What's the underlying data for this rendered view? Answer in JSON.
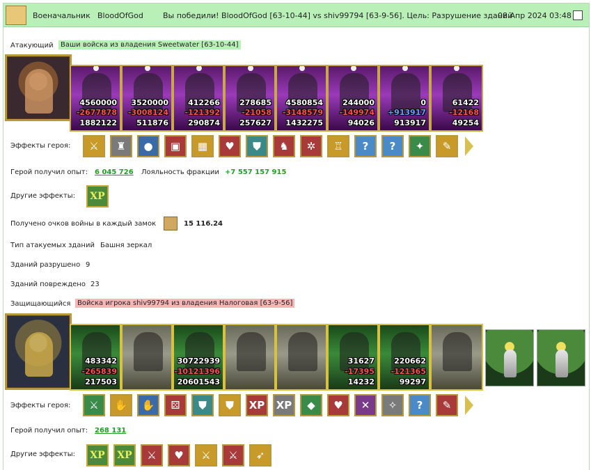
{
  "header": {
    "rank": "Военачальник",
    "player": "BloodOfGod",
    "result": "Вы победили! BloodOfGod [63-10-44] vs shiv99794 [63-9-56]. Цель: Разрушение зданий",
    "datetime": "08 Апр 2024 03:48"
  },
  "attacker": {
    "label": "Атакующий",
    "army_tag": "Ваши войска из владения Sweetwater [63-10-44]",
    "units": [
      {
        "count": "4560000",
        "loss": "-2677878",
        "left": "1882122",
        "loss_color": "red"
      },
      {
        "count": "3520000",
        "loss": "-3008124",
        "left": "511876",
        "loss_color": "red"
      },
      {
        "count": "412266",
        "loss": "-121392",
        "left": "290874",
        "loss_color": "red"
      },
      {
        "count": "278685",
        "loss": "-21058",
        "left": "257627",
        "loss_color": "red"
      },
      {
        "count": "4580854",
        "loss": "-3148579",
        "left": "1432275",
        "loss_color": "red"
      },
      {
        "count": "244000",
        "loss": "-149974",
        "left": "94026",
        "loss_color": "red"
      },
      {
        "count": "0",
        "loss": "+913917",
        "left": "913917",
        "loss_color": "blue"
      },
      {
        "count": "61422",
        "loss": "-12168",
        "left": "49254",
        "loss_color": "red"
      }
    ],
    "effects_label": "Эффекты героя:",
    "effects": [
      "gold-sword-icon",
      "helmet-icon",
      "orb-icon",
      "chest-icon",
      "treasure-icon",
      "heart-icon",
      "shield-icon",
      "armor-icon",
      "gear-icon",
      "cuirass-icon",
      "question-icon",
      "question-icon",
      "rune-icon",
      "scroll-icon"
    ],
    "exp_label": "Герой получил опыт:",
    "exp_value": "6 045 726",
    "loyalty_label": "Лояльность фракции",
    "loyalty_value": "+7 557 157 915",
    "other_label": "Другие эффекты:",
    "other_effects": [
      "XP"
    ],
    "war_points_label": "Получено очков войны в каждый замок",
    "war_points_value": "15 116.24",
    "building_type_label": "Тип атакуемых зданий",
    "building_type_value": "Башня зеркал",
    "destroyed_label": "Зданий разрушено",
    "destroyed_value": "9",
    "damaged_label": "Зданий повреждено",
    "damaged_value": "23"
  },
  "defender": {
    "label": "Защищающийся",
    "army_tag": "Войска игрока shiv99794 из владения Налоговая [63-9-56]",
    "units": [
      {
        "count": "483342",
        "loss": "-265839",
        "left": "217503",
        "style": "defg"
      },
      {
        "count": "",
        "loss": "",
        "left": "",
        "style": "def"
      },
      {
        "count": "30722939",
        "loss": "-10121396",
        "left": "20601543",
        "style": "defg"
      },
      {
        "count": "",
        "loss": "",
        "left": "",
        "style": "def"
      },
      {
        "count": "",
        "loss": "",
        "left": "",
        "style": "def"
      },
      {
        "count": "31627",
        "loss": "-17395",
        "left": "14232",
        "style": "defg"
      },
      {
        "count": "220662",
        "loss": "-121365",
        "left": "99297",
        "style": "defg"
      },
      {
        "count": "",
        "loss": "",
        "left": "",
        "style": "def"
      }
    ],
    "effects_label": "Эффекты героя:",
    "effects": [
      "sword-icon",
      "handshake-icon",
      "hand-icon",
      "dice-icon",
      "shield-icon",
      "hands-shield-icon",
      "xp-icon",
      "xp-crest-icon",
      "crystal-icon",
      "heart-gem-icon",
      "crossed-swords-icon",
      "wings-icon",
      "question-icon",
      "scroll-icon"
    ],
    "exp_label": "Герой получил опыт:",
    "exp_value": "268 131",
    "other_label": "Другие эффекты:",
    "other_effects": [
      "XP",
      "XP",
      "sword-shield-icon",
      "heart-icon",
      "sword-shield-icon",
      "sword-shield-icon",
      "archer-icon"
    ]
  }
}
